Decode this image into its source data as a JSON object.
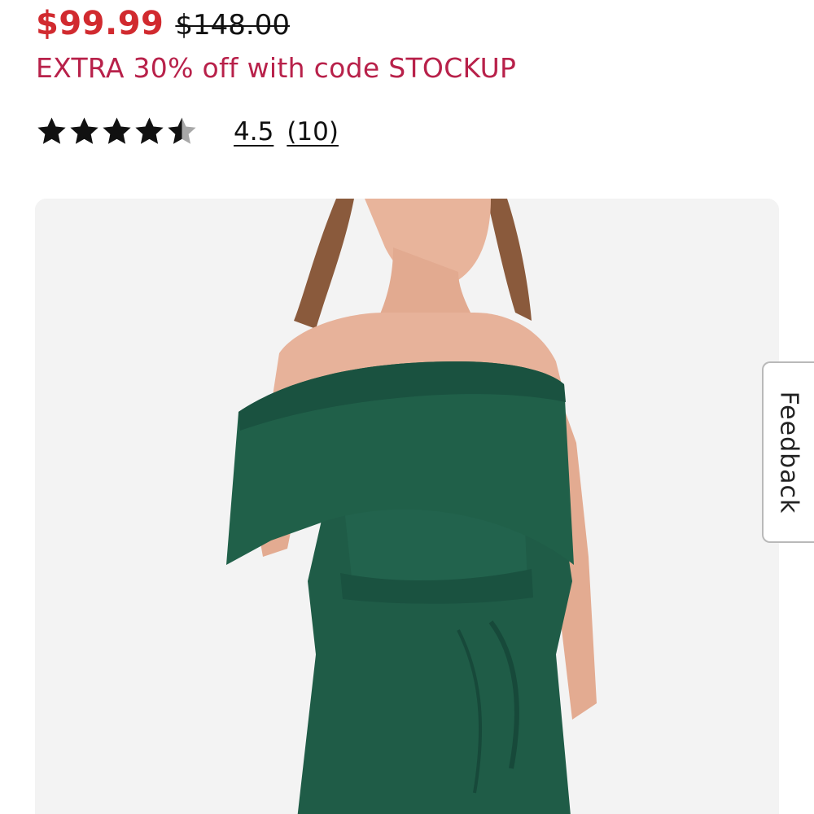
{
  "product": {
    "sale_price": "$99.99",
    "original_price": "$148.00",
    "promo_text": "EXTRA 30% off with code STOCKUP",
    "rating": {
      "stars_value": 4.5,
      "stars_max": 5,
      "average_label": "4.5",
      "count_label": "(10)"
    },
    "image": {
      "subject": "green off-shoulder dress",
      "dress_color": "#1f5c47"
    }
  },
  "feedback_tab": {
    "label": "Feedback"
  },
  "colors": {
    "sale_price": "#d12a2f",
    "promo": "#b8214a",
    "star_filled": "#111111",
    "star_empty": "#a8a8a8"
  }
}
